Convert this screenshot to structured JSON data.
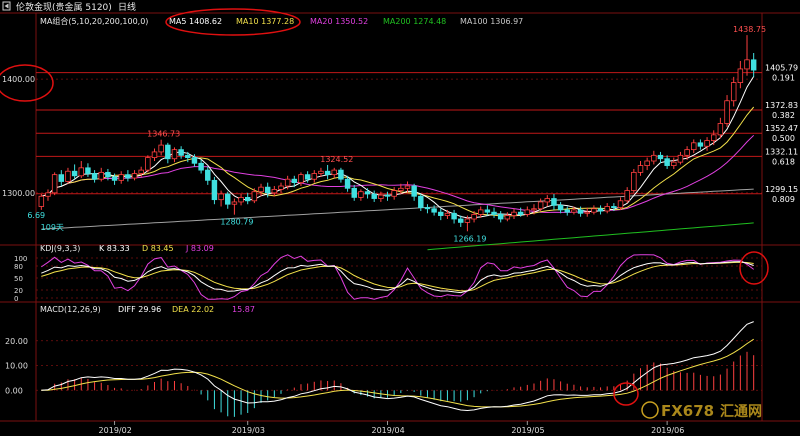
{
  "header": {
    "icon": "back-arrow-icon",
    "instrument": "伦敦金现(贵金属 5120)",
    "timeframe": "日线"
  },
  "ma_legend": {
    "title": "MA组合(5,10,20,200,100,0)",
    "items": [
      {
        "label": "MA5 1408.62",
        "color": "#ffffff"
      },
      {
        "label": "MA10 1377.28",
        "color": "#f2e04a"
      },
      {
        "label": "MA20 1350.52",
        "color": "#e040e0"
      },
      {
        "label": "MA200 1274.48",
        "color": "#20c020"
      },
      {
        "label": "MA100 1306.97",
        "color": "#c8c8c8"
      }
    ]
  },
  "kdj_legend": {
    "title": "KDJ(9,3,3)",
    "items": [
      {
        "label": "K 83.33",
        "color": "#ffffff"
      },
      {
        "label": "D 83.45",
        "color": "#f2e04a"
      },
      {
        "label": "J 83.09",
        "color": "#e040e0"
      }
    ]
  },
  "macd_legend": {
    "title": "MACD(12,26,9)",
    "items": [
      {
        "label": "DIFF 29.96",
        "color": "#ffffff"
      },
      {
        "label": "DEA 22.02",
        "color": "#f2e04a"
      },
      {
        "label": "15.87",
        "color": "#e040e0"
      }
    ]
  },
  "price_axis": {
    "ticks": [
      {
        "v": 1400,
        "label": "1400.00"
      },
      {
        "v": 1300,
        "label": "1300.00"
      }
    ]
  },
  "fib_levels": [
    {
      "price": 1405.79,
      "ratio": "0.191",
      "label": "1405.79"
    },
    {
      "price": 1372.83,
      "ratio": "0.382",
      "label": "1372.83"
    },
    {
      "price": 1352.47,
      "ratio": "0.500",
      "label": "1352.47"
    },
    {
      "price": 1332.11,
      "ratio": "0.618",
      "label": "1332.11"
    },
    {
      "price": 1299.15,
      "ratio": "0.809",
      "label": "1299.15"
    }
  ],
  "kdj_axis": {
    "ticks": [
      {
        "v": 100,
        "label": "100"
      },
      {
        "v": 80,
        "label": "80"
      },
      {
        "v": 50,
        "label": "50"
      },
      {
        "v": 20,
        "label": "20"
      },
      {
        "v": 0,
        "label": "0"
      }
    ]
  },
  "macd_axis": {
    "ticks": [
      {
        "v": 20,
        "label": "20.00"
      },
      {
        "v": 10,
        "label": "10.00"
      },
      {
        "v": 0,
        "label": "0.00"
      }
    ]
  },
  "months": [
    {
      "label": "2019/02",
      "idx": 11
    },
    {
      "label": "2019/03",
      "idx": 31
    },
    {
      "label": "2019/04",
      "idx": 52
    },
    {
      "label": "2019/05",
      "idx": 73
    },
    {
      "label": "2019/06",
      "idx": 94
    }
  ],
  "annotations": [
    {
      "label": "1346.73",
      "idx": 18,
      "price": 1346.73,
      "pos": "above",
      "color": "#ff5050"
    },
    {
      "label": "1324.52",
      "idx": 44,
      "price": 1324.52,
      "pos": "above",
      "color": "#ff5050"
    },
    {
      "label": "1438.75",
      "idx": 106,
      "price": 1438.75,
      "pos": "above",
      "color": "#ff5050"
    },
    {
      "label": "1280.79",
      "idx": 29,
      "price": 1280.79,
      "pos": "below",
      "color": "#40e0e0"
    },
    {
      "label": "1266.19",
      "idx": 64,
      "price": 1266.19,
      "pos": "below",
      "color": "#40e0e0"
    },
    {
      "label": "6.69",
      "idx": 0,
      "price": 1286.69,
      "pos": "below",
      "color": "#40e0e0"
    },
    {
      "label": "109天",
      "idx": 2,
      "price": 1276,
      "pos": "below",
      "color": "#40e0e0"
    }
  ],
  "watermark": {
    "brand": "FX678",
    "cn": "汇通网"
  },
  "chart_data": {
    "type": "candlestick",
    "candles_ohlc": [
      [
        1288,
        1297,
        1285,
        1299
      ],
      [
        1297,
        1300,
        1293,
        1303
      ],
      [
        1300,
        1316,
        1298,
        1318
      ],
      [
        1316,
        1310,
        1306,
        1320
      ],
      [
        1310,
        1319,
        1308,
        1322
      ],
      [
        1319,
        1315,
        1312,
        1325
      ],
      [
        1315,
        1322,
        1313,
        1328
      ],
      [
        1322,
        1317,
        1314,
        1326
      ],
      [
        1317,
        1312,
        1309,
        1320
      ],
      [
        1312,
        1318,
        1310,
        1322
      ],
      [
        1318,
        1314,
        1311,
        1321
      ],
      [
        1314,
        1311,
        1307,
        1317
      ],
      [
        1311,
        1316,
        1308,
        1319
      ],
      [
        1316,
        1313,
        1310,
        1320
      ],
      [
        1313,
        1317,
        1311,
        1320
      ],
      [
        1317,
        1320,
        1314,
        1323
      ],
      [
        1320,
        1331,
        1318,
        1333
      ],
      [
        1331,
        1336,
        1328,
        1339
      ],
      [
        1336,
        1342,
        1333,
        1346.73
      ],
      [
        1342,
        1330,
        1326,
        1344
      ],
      [
        1330,
        1338,
        1327,
        1340
      ],
      [
        1338,
        1333,
        1330,
        1341
      ],
      [
        1333,
        1331,
        1327,
        1336
      ],
      [
        1331,
        1326,
        1323,
        1334
      ],
      [
        1326,
        1320,
        1317,
        1329
      ],
      [
        1320,
        1311,
        1307,
        1323
      ],
      [
        1311,
        1294,
        1290,
        1314
      ],
      [
        1294,
        1299,
        1288,
        1302
      ],
      [
        1299,
        1290,
        1286,
        1301
      ],
      [
        1290,
        1292,
        1280.79,
        1295
      ],
      [
        1292,
        1296,
        1289,
        1299
      ],
      [
        1296,
        1293,
        1290,
        1300
      ],
      [
        1293,
        1301,
        1291,
        1304
      ],
      [
        1301,
        1305,
        1297,
        1308
      ],
      [
        1305,
        1300,
        1296,
        1309
      ],
      [
        1300,
        1303,
        1297,
        1306
      ],
      [
        1303,
        1306,
        1300,
        1309
      ],
      [
        1306,
        1312,
        1303,
        1315
      ],
      [
        1312,
        1309,
        1305,
        1315
      ],
      [
        1309,
        1316,
        1306,
        1318
      ],
      [
        1316,
        1312,
        1309,
        1319
      ],
      [
        1312,
        1317,
        1309,
        1320
      ],
      [
        1317,
        1319,
        1314,
        1322
      ],
      [
        1319,
        1316,
        1312,
        1324.52
      ],
      [
        1316,
        1320,
        1313,
        1322
      ],
      [
        1320,
        1312,
        1309,
        1322
      ],
      [
        1312,
        1304,
        1301,
        1315
      ],
      [
        1304,
        1296,
        1293,
        1307
      ],
      [
        1296,
        1301,
        1293,
        1303
      ],
      [
        1301,
        1299,
        1295,
        1304
      ],
      [
        1299,
        1295,
        1292,
        1302
      ],
      [
        1295,
        1298,
        1292,
        1301
      ],
      [
        1298,
        1297,
        1293,
        1301
      ],
      [
        1297,
        1302,
        1294,
        1305
      ],
      [
        1302,
        1304,
        1299,
        1308
      ],
      [
        1304,
        1306,
        1300,
        1310
      ],
      [
        1306,
        1297,
        1293,
        1308
      ],
      [
        1297,
        1287,
        1284,
        1299
      ],
      [
        1287,
        1286,
        1282,
        1290
      ],
      [
        1286,
        1283,
        1280,
        1289
      ],
      [
        1283,
        1280,
        1276,
        1286
      ],
      [
        1280,
        1282,
        1277,
        1285
      ],
      [
        1282,
        1277,
        1273,
        1285
      ],
      [
        1277,
        1274,
        1270,
        1280
      ],
      [
        1274,
        1277,
        1266.19,
        1280
      ],
      [
        1277,
        1281,
        1274,
        1284
      ],
      [
        1281,
        1285,
        1278,
        1288
      ],
      [
        1285,
        1283,
        1280,
        1289
      ],
      [
        1283,
        1281,
        1278,
        1287
      ],
      [
        1281,
        1277,
        1274,
        1284
      ],
      [
        1277,
        1280,
        1275,
        1283
      ],
      [
        1280,
        1283,
        1277,
        1286
      ],
      [
        1283,
        1281,
        1279,
        1287
      ],
      [
        1281,
        1285,
        1279,
        1288
      ],
      [
        1285,
        1286,
        1281,
        1290
      ],
      [
        1286,
        1292,
        1284,
        1295
      ],
      [
        1292,
        1295,
        1288,
        1298
      ],
      [
        1295,
        1289,
        1285,
        1299
      ],
      [
        1289,
        1285,
        1282,
        1292
      ],
      [
        1285,
        1283,
        1280,
        1288
      ],
      [
        1283,
        1285,
        1281,
        1288
      ],
      [
        1285,
        1282,
        1279,
        1288
      ],
      [
        1282,
        1283,
        1279,
        1287
      ],
      [
        1283,
        1286,
        1281,
        1289
      ],
      [
        1286,
        1284,
        1281,
        1289
      ],
      [
        1284,
        1288,
        1282,
        1291
      ],
      [
        1288,
        1287,
        1284,
        1291
      ],
      [
        1287,
        1293,
        1285,
        1296
      ],
      [
        1293,
        1302,
        1291,
        1305
      ],
      [
        1302,
        1318,
        1300,
        1321
      ],
      [
        1318,
        1324,
        1315,
        1328
      ],
      [
        1324,
        1328,
        1320,
        1331
      ],
      [
        1328,
        1333,
        1325,
        1337
      ],
      [
        1333,
        1330,
        1326,
        1336
      ],
      [
        1330,
        1324,
        1321,
        1333
      ],
      [
        1324,
        1327,
        1321,
        1331
      ],
      [
        1327,
        1333,
        1325,
        1336
      ],
      [
        1333,
        1338,
        1329,
        1341
      ],
      [
        1338,
        1344,
        1335,
        1347
      ],
      [
        1344,
        1341,
        1338,
        1347
      ],
      [
        1341,
        1346,
        1337,
        1349
      ],
      [
        1346,
        1351,
        1342,
        1355
      ],
      [
        1351,
        1361,
        1348,
        1366
      ],
      [
        1361,
        1381,
        1358,
        1386
      ],
      [
        1381,
        1397,
        1376,
        1402
      ],
      [
        1397,
        1409,
        1392,
        1416
      ],
      [
        1409,
        1417,
        1403,
        1438.75
      ],
      [
        1417,
        1408,
        1402,
        1423
      ]
    ],
    "ylim": [
      1255,
      1445
    ],
    "kdj_ylim": [
      -5,
      110
    ],
    "macd_ylim": [
      -12,
      30
    ]
  }
}
